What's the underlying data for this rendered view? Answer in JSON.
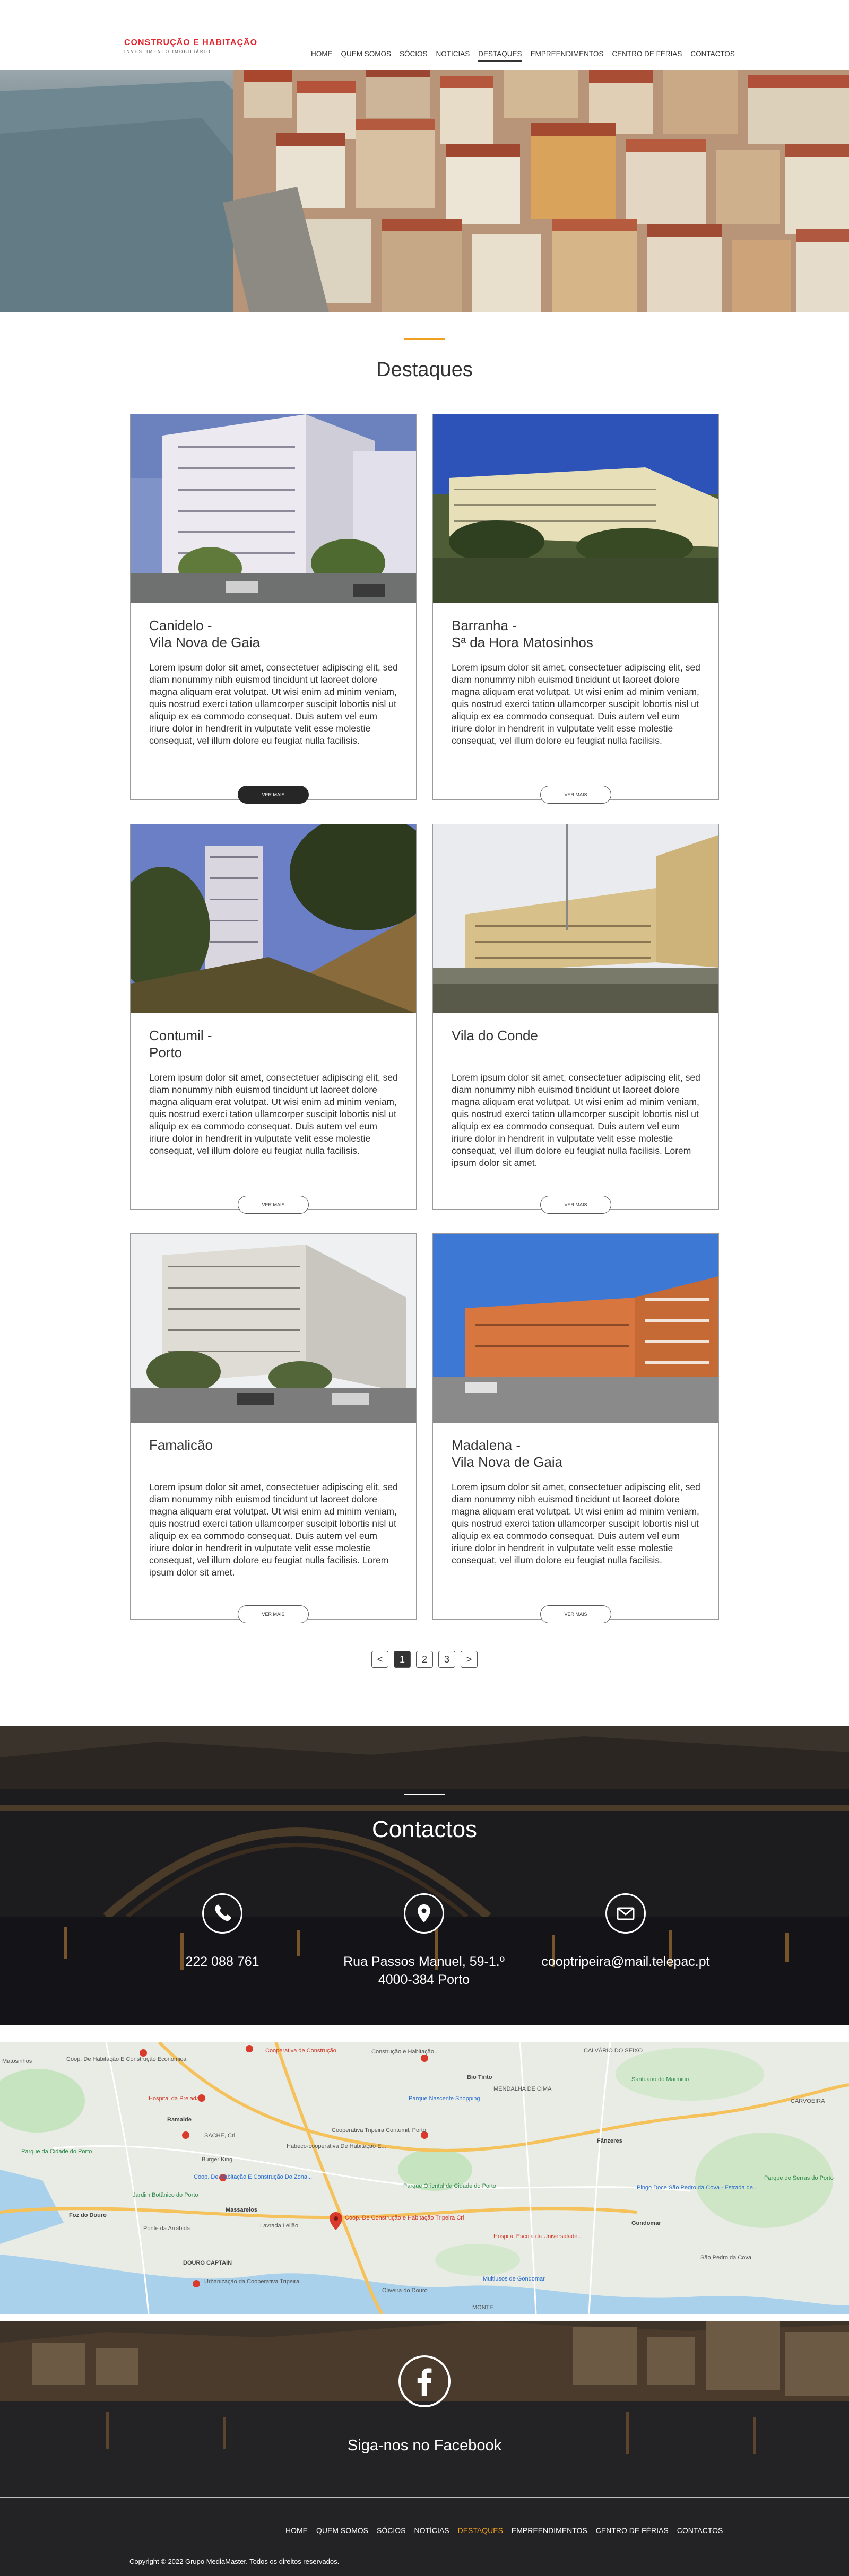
{
  "brand": {
    "name": "CONSTRUÇÃO E HABITAÇÃO",
    "tagline": "INVESTIMENTO IMOBILIÁRIO",
    "accent": "#e2262e",
    "highlight": "#f0a020"
  },
  "nav": {
    "items": [
      "HOME",
      "QUEM SOMOS",
      "SÓCIOS",
      "NOTÍCIAS",
      "DESTAQUES",
      "EMPREENDIMENTOS",
      "CENTRO DE FÉRIAS",
      "CONTACTOS"
    ],
    "active": "DESTAQUES"
  },
  "section": {
    "title": "Destaques"
  },
  "cards": [
    {
      "title": "Canidelo -\nVila Nova de Gaia",
      "text": "Lorem ipsum dolor sit amet, consectetuer adipiscing elit, sed diam nonummy nibh euismod tincidunt ut laoreet dolore magna aliquam erat volutpat. Ut wisi enim ad minim veniam, quis nostrud exerci tation ullamcorper suscipit lobortis nisl ut aliquip ex ea commodo consequat. Duis autem vel eum iriure dolor in hendrerit in vulputate velit esse molestie consequat, vel illum dolore eu feugiat nulla facilisis.",
      "button": "VER MAIS"
    },
    {
      "title": "Barranha -\nSª da Hora Matosinhos",
      "text": "Lorem ipsum dolor sit amet, consectetuer adipiscing elit, sed diam nonummy nibh euismod tincidunt ut laoreet dolore magna aliquam erat volutpat. Ut wisi enim ad minim veniam, quis nostrud exerci tation ullamcorper suscipit lobortis nisl ut aliquip ex ea commodo consequat. Duis autem vel eum iriure dolor in hendrerit in vulputate velit esse molestie consequat, vel illum dolore eu feugiat nulla facilisis.",
      "button": "VER MAIS"
    },
    {
      "title": "Contumil -\nPorto",
      "text": "Lorem ipsum dolor sit amet, consectetuer adipiscing elit, sed diam nonummy nibh euismod tincidunt ut laoreet dolore magna aliquam erat volutpat. Ut wisi enim ad minim veniam, quis nostrud exerci tation ullamcorper suscipit lobortis nisl ut aliquip ex ea commodo consequat. Duis autem vel eum iriure dolor in hendrerit in vulputate velit esse molestie consequat, vel illum dolore eu feugiat nulla facilisis.",
      "button": "VER MAIS"
    },
    {
      "title": "Vila do Conde",
      "text": "Lorem ipsum dolor sit amet, consectetuer adipiscing elit, sed diam nonummy nibh euismod tincidunt ut laoreet dolore magna aliquam erat volutpat. Ut wisi enim ad minim veniam, quis nostrud exerci tation ullamcorper suscipit lobortis nisl ut aliquip ex ea commodo consequat. Duis autem vel eum iriure dolor in hendrerit in vulputate velit esse molestie consequat, vel illum dolore eu feugiat nulla facilisis. Lorem ipsum dolor sit amet.",
      "button": "VER MAIS"
    },
    {
      "title": "Famalicão",
      "text": "Lorem ipsum dolor sit amet, consectetuer adipiscing elit, sed diam nonummy nibh euismod tincidunt ut laoreet dolore magna aliquam erat volutpat. Ut wisi enim ad minim veniam, quis nostrud exerci tation ullamcorper suscipit lobortis nisl ut aliquip ex ea commodo consequat. Duis autem vel eum iriure dolor in hendrerit in vulputate velit esse molestie consequat, vel illum dolore eu feugiat nulla facilisis. Lorem ipsum dolor sit amet.",
      "button": "VER MAIS"
    },
    {
      "title": "Madalena -\nVila Nova de Gaia",
      "text": "Lorem ipsum dolor sit amet, consectetuer adipiscing elit, sed diam nonummy nibh euismod tincidunt ut laoreet dolore magna aliquam erat volutpat. Ut wisi enim ad minim veniam, quis nostrud exerci tation ullamcorper suscipit lobortis nisl ut aliquip ex ea commodo consequat. Duis autem vel eum iriure dolor in hendrerit in vulputate velit esse molestie consequat, vel illum dolore eu feugiat nulla facilisis.",
      "button": "VER MAIS"
    }
  ],
  "pagination": {
    "prev": "<",
    "pages": [
      "1",
      "2",
      "3"
    ],
    "current": "1",
    "next": ">"
  },
  "contacts": {
    "title": "Contactos",
    "phone": "222 088 761",
    "address": "Rua Passos Manuel, 59-1.º\n4000-384 Porto",
    "email": "cooptripeira@mail.telepac.pt"
  },
  "map": {
    "labels": [
      "Coop. De Habitação E Construção Economica",
      "Cooperativa de Construção",
      "Construção e Habitação...",
      "CALVÁRIO DO SEIXO",
      "Hospital da Prelada",
      "Bio Tinto",
      "Santuário do Marmino",
      "Ramalde",
      "Parque Nascente Shopping",
      "MENDALHA DE CIMA",
      "CARVOEIRA",
      "SACHE, Crl.",
      "Habeco-cooperativa De Habitação E...",
      "Cooperativa Tripeira Contumil, Porto",
      "Fânzeres",
      "Burger King",
      "Coop. De Habitação E Construção Do Zona...",
      "Parque Oriental da Cidade do Porto",
      "Jardim Botânico do Porto",
      "Massarelos",
      "Lavrada Leilão",
      "Coop. De Construção e Habitação Tripeira Crl",
      "Pingo Doce São Pedro da Cova - Estrada de...",
      "Gondomar",
      "Foz do Douro",
      "Ponte da Arrábida",
      "Hospital Escola da Universidade...",
      "São Pedro da Cova",
      "DOURO CAPTAIN",
      "Multiusos de Gondomar",
      "Urbanização da Cooperativa Tripeira",
      "Oliveira do Douro",
      "MONTE",
      "Parque de Serras do Porto",
      "Parque da Cidade do Porto",
      "Matosinhos"
    ]
  },
  "facebook": {
    "label": "Siga-nos no Facebook",
    "icon": "facebook-icon"
  },
  "footer": {
    "nav": [
      "HOME",
      "QUEM SOMOS",
      "SÓCIOS",
      "NOTÍCIAS",
      "DESTAQUES",
      "EMPREENDIMENTOS",
      "CENTRO DE FÉRIAS",
      "CONTACTOS"
    ],
    "active": "DESTAQUES",
    "copyright": "Copyright © 2022 Grupo MediaMaster. Todos os direitos reservados."
  }
}
